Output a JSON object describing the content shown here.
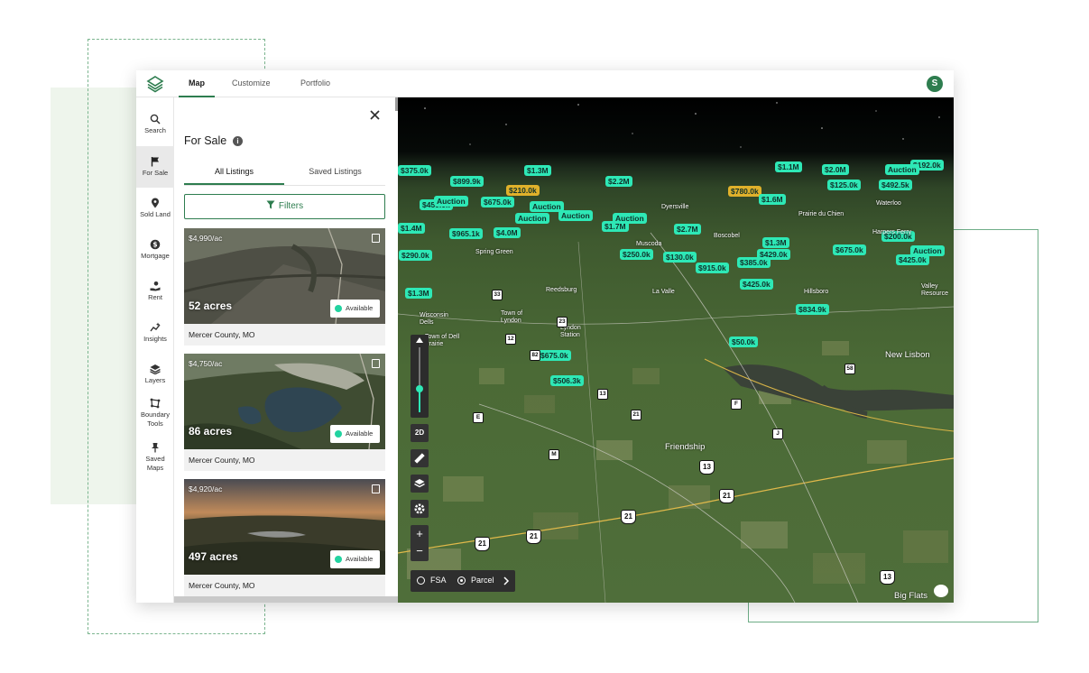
{
  "app": {
    "tabs": [
      {
        "label": "Map"
      },
      {
        "label": "Customize"
      },
      {
        "label": "Portfolio"
      }
    ],
    "avatar_initial": "S"
  },
  "nav": {
    "items": [
      {
        "label": "Search",
        "icon": "search-icon"
      },
      {
        "label": "For Sale",
        "icon": "flag-icon"
      },
      {
        "label": "Sold Land",
        "icon": "map-pin-icon"
      },
      {
        "label": "Mortgage",
        "icon": "dollar-coin-icon"
      },
      {
        "label": "Rent",
        "icon": "hand-coin-icon"
      },
      {
        "label": "Insights",
        "icon": "sparkle-chart-icon"
      },
      {
        "label": "Layers",
        "icon": "layers-icon"
      },
      {
        "label": "Boundary Tools",
        "icon": "polygon-icon"
      },
      {
        "label": "Saved Maps",
        "icon": "pushpin-icon"
      }
    ]
  },
  "panel": {
    "title": "For Sale",
    "tabs": [
      {
        "label": "All Listings"
      },
      {
        "label": "Saved Listings"
      }
    ],
    "filters_label": "Filters",
    "listings": [
      {
        "price": "$4,990/ac",
        "acres": "52 acres",
        "status": "Available",
        "location": "Mercer County, MO"
      },
      {
        "price": "$4,750/ac",
        "acres": "86 acres",
        "status": "Available",
        "location": "Mercer County, MO"
      },
      {
        "price": "$4,920/ac",
        "acres": "497 acres",
        "status": "Available",
        "location": "Mercer County, MO"
      }
    ]
  },
  "map": {
    "prices": [
      "$375.0k",
      "$1.3M",
      "$1.1M",
      "$2.0M",
      "$192.0k",
      "$899.9k",
      "$2.2M",
      "$125.0k",
      "$492.5k",
      "$210.0k",
      "$780.0k",
      "$1.6M",
      "$450.0k",
      "$675.0k",
      "$2.7M",
      "$1.4M",
      "$965.1k",
      "$4.0M",
      "$1.7M",
      "$200.0k",
      "$1.3M",
      "$675.0k",
      "$290.0k",
      "$250.0k",
      "$130.0k",
      "$429.0k",
      "$425.0k",
      "$915.0k",
      "$385.0k",
      "$1.3M",
      "$425.0k",
      "$834.9k",
      "$50.0k",
      "$675.0k",
      "$506.3k"
    ],
    "auction_label": "Auction",
    "towns": [
      "Spring Green",
      "Muscoda",
      "Boscobel",
      "Reedsburg",
      "La Valle",
      "Hillsboro",
      "Wisconsin Dells",
      "Town of Lyndon",
      "Lyndon Station",
      "Town of Dell Prairie",
      "New Lisbon",
      "Friendship",
      "Big Flats",
      "Dyersville",
      "Waterloo",
      "Harpers Ferry",
      "Valley Resource",
      "Prairie du Chien"
    ],
    "route_shields": [
      "82",
      "12",
      "23",
      "33",
      "13",
      "21",
      "58",
      "E",
      "F",
      "J",
      "M",
      "13",
      "21",
      "21",
      "21",
      "21",
      "13"
    ],
    "controls": {
      "view_mode": "2D",
      "zoom_in": "+",
      "zoom_out": "−"
    },
    "layer_options": [
      {
        "label": "FSA",
        "selected": false
      },
      {
        "label": "Parcel",
        "selected": true
      }
    ]
  },
  "colors": {
    "brand": "#2e7d4f",
    "price_tag": "#2ee8b6",
    "available_dot": "#22d3a0"
  }
}
